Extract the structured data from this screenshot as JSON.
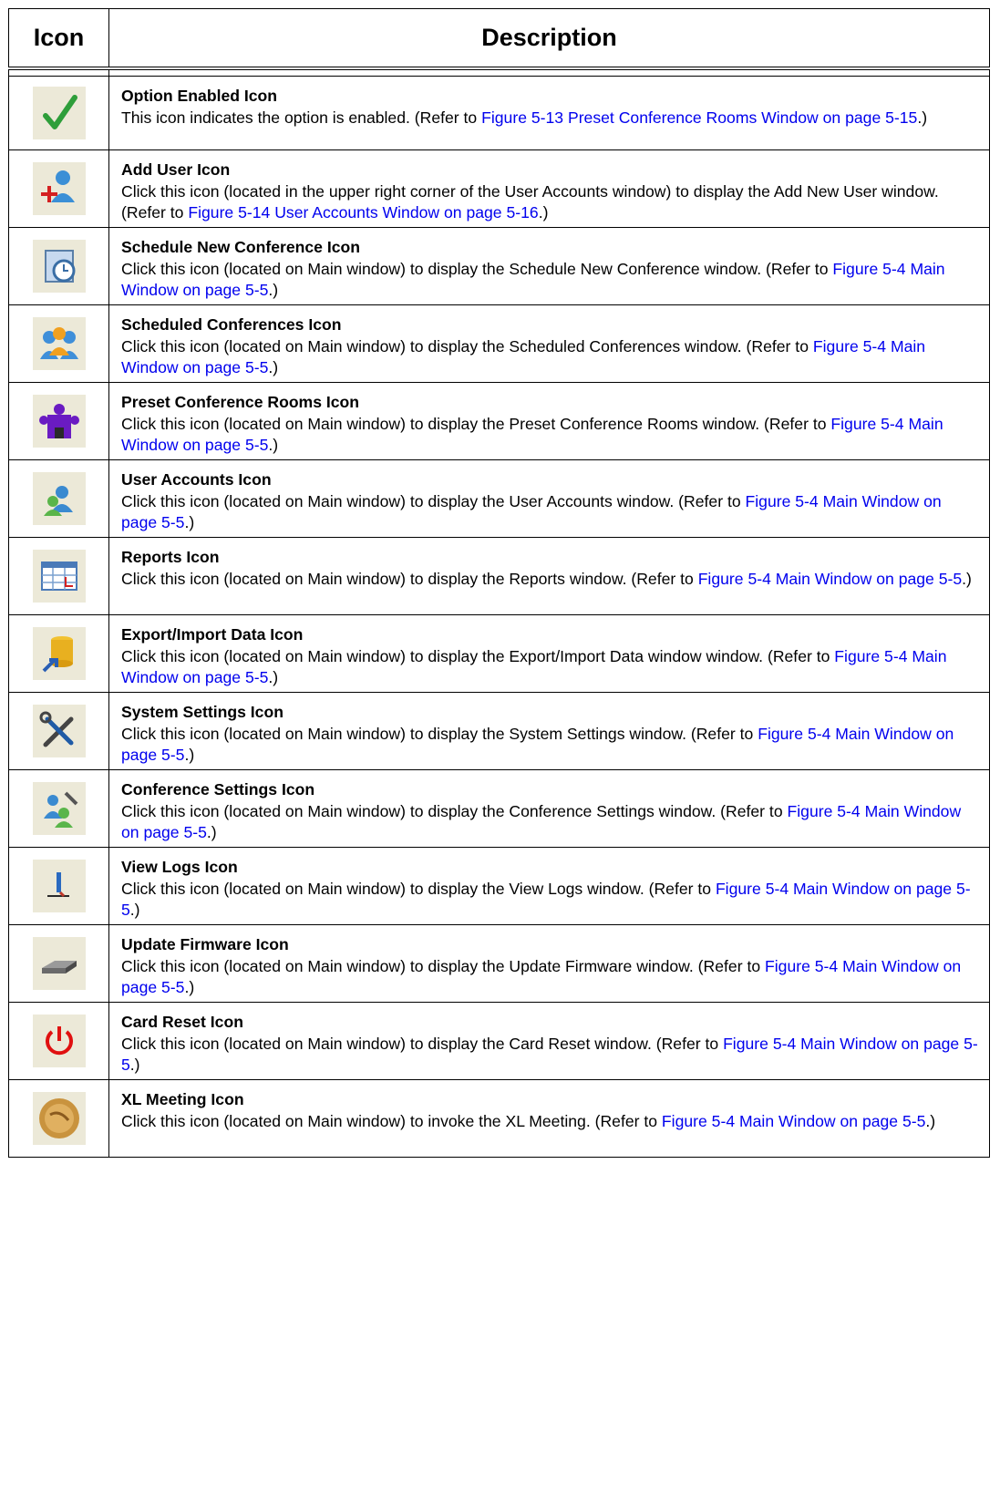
{
  "table": {
    "headers": {
      "icon": "Icon",
      "description": "Description"
    },
    "rows": [
      {
        "icon": "checkmark-icon",
        "title": "Option Enabled Icon",
        "text": "This icon indicates the option is enabled.   (Refer to ",
        "link": "Figure 5-13 Preset Conference Rooms Window on page 5-15",
        "after": ".)"
      },
      {
        "icon": "add-user-icon",
        "title": "Add User Icon",
        "text": "Click this icon (located in the upper right corner of the User Accounts window) to display the Add New User window. (Refer to ",
        "link": "Figure 5-14 User Accounts Window on page 5-16",
        "after": ".)"
      },
      {
        "icon": "schedule-clock-icon",
        "title": "Schedule New Conference Icon",
        "text": "Click this icon (located on Main window) to display the Schedule New Conference window. (Refer to ",
        "link": "Figure 5-4 Main Window on page 5-5",
        "after": ".)"
      },
      {
        "icon": "group-people-icon",
        "title": "Scheduled Conferences Icon",
        "text": "Click this icon (located on Main window) to display the Scheduled Conferences window. (Refer to ",
        "link": "Figure 5-4 Main Window on page 5-5",
        "after": ".)"
      },
      {
        "icon": "conference-room-icon",
        "title": "Preset Conference Rooms Icon",
        "text": "Click this icon (located on Main window) to display the Preset Conference Rooms window. (Refer to ",
        "link": "Figure 5-4 Main Window on page 5-5",
        "after": ".)"
      },
      {
        "icon": "user-accounts-icon",
        "title": "User Accounts Icon",
        "text": "Click this icon (located on Main window) to display the User Accounts window. (Refer to ",
        "link": "Figure 5-4 Main Window on page 5-5",
        "after": ".)"
      },
      {
        "icon": "calendar-report-icon",
        "title": "Reports Icon",
        "text": "Click this icon (located on Main window) to display the Reports window. (Refer to ",
        "link": "Figure 5-4 Main Window on page 5-5",
        "after": ".)"
      },
      {
        "icon": "database-export-icon",
        "title": "Export/Import Data Icon",
        "text": "Click this icon (located on Main window) to display the Export/Import Data window window. (Refer to ",
        "link": "Figure 5-4 Main Window on page 5-5",
        "after": ".)"
      },
      {
        "icon": "tools-icon",
        "title": "System Settings Icon",
        "text": "Click this icon (located on Main window) to display the System Settings window. (Refer to ",
        "link": "Figure 5-4 Main Window on page 5-5",
        "after": ".)"
      },
      {
        "icon": "conference-settings-icon",
        "title": "Conference Settings Icon",
        "text": "Click this icon (located on Main window) to display the Conference Settings window. (Refer to ",
        "link": "Figure 5-4 Main Window on page 5-5",
        "after": ".)"
      },
      {
        "icon": "view-logs-icon",
        "title": "View Logs Icon",
        "text": "Click this icon (located on Main window) to display the View Logs window. (Refer to ",
        "link": "Figure 5-4 Main Window on page 5-5",
        "after": ".)"
      },
      {
        "icon": "firmware-drive-icon",
        "title": "Update Firmware Icon",
        "text": "Click this icon (located on Main window) to display the Update Firmware window. (Refer to ",
        "link": "Figure 5-4 Main Window on page 5-5",
        "after": ".)"
      },
      {
        "icon": "power-icon",
        "title": "Card Reset Icon",
        "text": "Click this icon (located on Main window) to display the Card Reset window. (Refer to ",
        "link": "Figure 5-4 Main Window on page 5-5",
        "after": ".)"
      },
      {
        "icon": "xl-meeting-icon",
        "title": "XL Meeting Icon",
        "text": "Click this icon (located on Main window) to invoke the XL Meeting. (Refer to ",
        "link": "Figure 5-4 Main Window on page 5-5",
        "after": ".)"
      }
    ]
  }
}
